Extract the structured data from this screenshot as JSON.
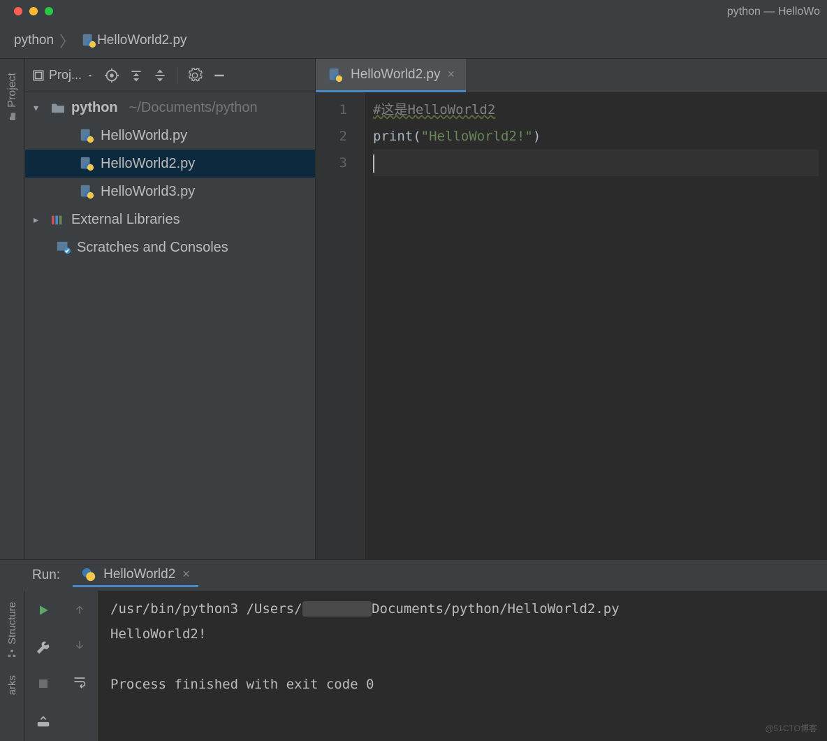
{
  "window": {
    "title": "python — HelloWo"
  },
  "breadcrumb": {
    "project": "python",
    "file": "HelloWorld2.py"
  },
  "projectPanel": {
    "label": "Proj...",
    "tree": {
      "root": {
        "name": "python",
        "path": "~/Documents/python"
      },
      "files": [
        {
          "name": "HelloWorld.py",
          "selected": false
        },
        {
          "name": "HelloWorld2.py",
          "selected": true
        },
        {
          "name": "HelloWorld3.py",
          "selected": false
        }
      ],
      "external": "External Libraries",
      "scratches": "Scratches and Consoles"
    }
  },
  "leftRail": {
    "project": "Project",
    "structure": "Structure",
    "arks": "arks"
  },
  "editor": {
    "tabLabel": "HelloWorld2.py",
    "lines": [
      "1",
      "2",
      "3"
    ],
    "code": {
      "l1_comment": "#这是HelloWorld2",
      "l2_fn": "print",
      "l2_open": "(",
      "l2_str": "\"HelloWorld2!\"",
      "l2_close": ")"
    }
  },
  "run": {
    "label": "Run:",
    "tab": "HelloWorld2",
    "console": {
      "line1a": "/usr/bin/python3 /Users/",
      "line1b": "Documents/python/HelloWorld2.py",
      "line2": "HelloWorld2!",
      "line3": "Process finished with exit code 0"
    }
  },
  "watermark": "@51CTO博客"
}
